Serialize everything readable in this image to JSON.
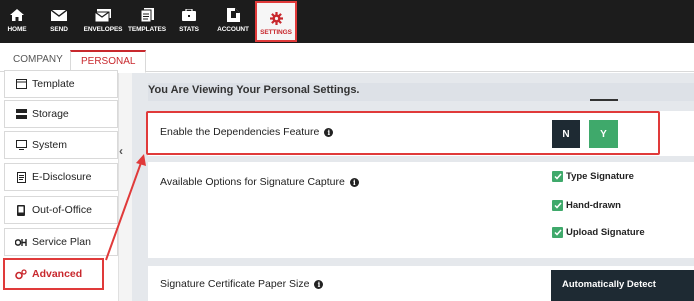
{
  "topnav": {
    "items": [
      {
        "label": "HOME",
        "icon": "home-icon"
      },
      {
        "label": "SEND",
        "icon": "envelope-icon"
      },
      {
        "label": "ENVELOPES",
        "icon": "envelopes-icon"
      },
      {
        "label": "TEMPLATES",
        "icon": "templates-icon"
      },
      {
        "label": "STATS",
        "icon": "stats-icon"
      },
      {
        "label": "ACCOUNT",
        "icon": "account-icon"
      },
      {
        "label": "SETTINGS",
        "icon": "gear-icon"
      }
    ],
    "active": "SETTINGS"
  },
  "tabs": [
    {
      "label": "COMPANY"
    },
    {
      "label": "PERSONAL"
    }
  ],
  "sidebar": {
    "items": [
      {
        "label": "Template",
        "icon": "template-icon"
      },
      {
        "label": "Storage",
        "icon": "storage-icon"
      },
      {
        "label": "System",
        "icon": "monitor-icon"
      },
      {
        "label": "E-Disclosure",
        "icon": "document-icon"
      },
      {
        "label": "Out-of-Office",
        "icon": "phone-icon"
      },
      {
        "label": "Service Plan",
        "icon": "service-icon"
      },
      {
        "label": "Advanced",
        "icon": "gears-icon"
      }
    ],
    "active": "Advanced"
  },
  "main": {
    "banner": "You Are Viewing Your Personal Settings.",
    "dependencies": {
      "label": "Enable the Dependencies Feature",
      "no_label": "N",
      "yes_label": "Y"
    },
    "signature_capture": {
      "label": "Available Options for Signature Capture",
      "options": [
        {
          "label": "Type Signature",
          "checked": true
        },
        {
          "label": "Hand-drawn",
          "checked": true
        },
        {
          "label": "Upload Signature",
          "checked": true
        }
      ]
    },
    "paper_size": {
      "label": "Signature Certificate Paper Size",
      "value": "Automatically Detect"
    }
  },
  "colors": {
    "accent": "#c8282d",
    "highlight": "#e03a3a",
    "nav_bg": "#1c1c1c",
    "yes_green": "#3fa96b",
    "dark_button": "#1e2a33"
  }
}
